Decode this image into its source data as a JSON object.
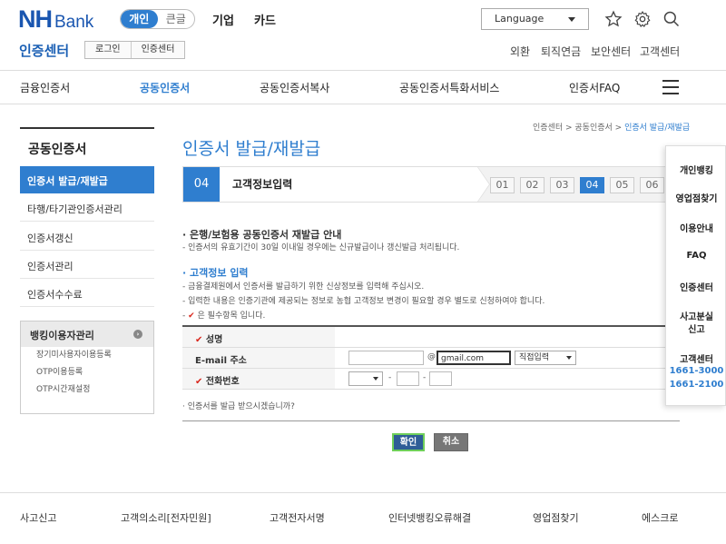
{
  "header": {
    "logo_main": "NH",
    "logo_sub": "Bank",
    "segments": [
      "개인",
      "큰글"
    ],
    "topnav": [
      "기업",
      "카드"
    ],
    "language": "Language",
    "cert_center": "인증센터",
    "cert_buttons": [
      "로그인",
      "인증센터"
    ],
    "util_links": [
      "외환",
      "퇴직연금",
      "보안센터",
      "고객센터"
    ]
  },
  "gnb": [
    "금융인증서",
    "공동인증서",
    "공동인증서복사",
    "공동인증서특화서비스",
    "인증서FAQ"
  ],
  "lnb": {
    "title": "공동인증서",
    "items": [
      "인증서 발급/재발급",
      "타행/타기관인증서관리",
      "인증서갱신",
      "인증서관리",
      "인증서수수료"
    ],
    "bank_title": "뱅킹이용자관리",
    "bank_items": [
      "장기미사용자이용등록",
      "OTP이용등록",
      "OTP시간재설정"
    ]
  },
  "breadcrumb": [
    "인증센터",
    "공동인증서",
    "인증서 발급/재발급"
  ],
  "page_title": "인증서 발급/재발급",
  "step": {
    "num": "04",
    "name": "고객정보입력",
    "boxes": [
      "01",
      "02",
      "03",
      "04",
      "05",
      "06"
    ]
  },
  "notice": {
    "head": "· 은행/보험용 공동인증서 재발급 안내",
    "text": "- 인증서의 유효기간이 30일 이내일 경우에는 신규발급이나 갱신발급 처리됩니다."
  },
  "info": {
    "head": "· 고객정보 입력",
    "line1": "- 금융결제원에서 인증서를 발급하기 위한 신상정보를 입력해 주십시오.",
    "line2": "- 입력한 내용은 인증기관에 제공되는 정보로 농협 고객정보 변경이 필요할 경우 별도로 신청하여야 합니다.",
    "required_mark": "✔",
    "required": "은 필수항목 입니다."
  },
  "form": {
    "name_label": "성명",
    "email_label": "E-mail 주소",
    "email_domain": "gmail.com",
    "email_select": "직접입력",
    "phone_label": "전화번호",
    "at": "@",
    "dash": "-",
    "check": "✔"
  },
  "ask": "· 인증서를 발급 받으시겠습니까?",
  "buttons": {
    "ok": "확인",
    "cancel": "취소"
  },
  "quick": {
    "items": [
      "개인뱅킹",
      "영업점찾기",
      "이용안내",
      "FAQ",
      "인증센터",
      "사고분실",
      "신고",
      "고객센터"
    ],
    "phones": [
      "1661-3000",
      "1661-2100"
    ]
  },
  "footer": [
    "사고신고",
    "고객의소리[전자민원]",
    "고객전자서명",
    "인터넷뱅킹오류해결",
    "영업점찾기",
    "에스크로"
  ]
}
